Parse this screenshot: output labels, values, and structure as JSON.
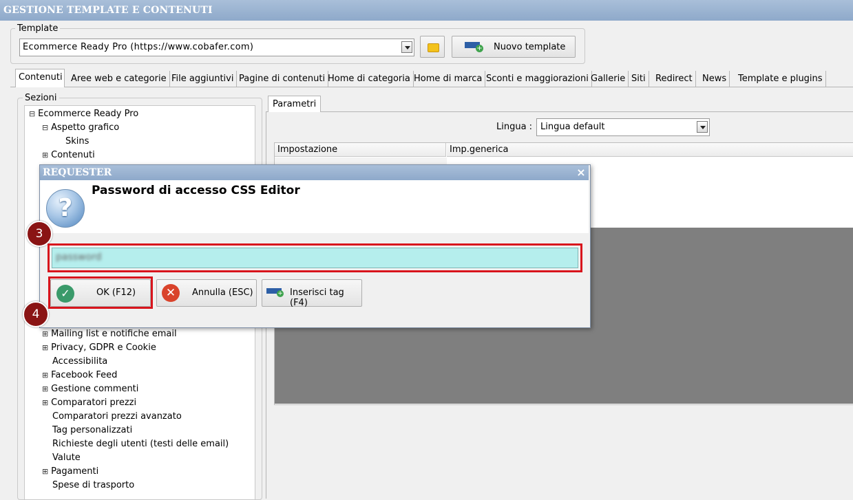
{
  "window": {
    "title": "GESTIONE TEMPLATE E CONTENUTI"
  },
  "template_group": {
    "legend": "Template",
    "selected": "Ecommerce Ready Pro (https://www.cobafer.com)",
    "new_button_label": "Nuovo template"
  },
  "tabs": [
    "Contenuti",
    "Aree web e categorie",
    "File aggiuntivi",
    "Pagine di contenuti",
    "Home di categoria",
    "Home di marca",
    "Sconti e maggiorazioni",
    "Gallerie",
    "Siti",
    "Redirect",
    "News",
    "Template e plugins"
  ],
  "sections": {
    "legend": "Sezioni",
    "tree": [
      "Ecommerce Ready Pro",
      "Aspetto grafico",
      "Skins",
      "Contenuti",
      "Mailing list e notifiche email",
      "Privacy, GDPR e Cookie",
      "Accessibilita",
      "Facebook Feed",
      "Gestione commenti",
      "Comparatori prezzi",
      "Comparatori prezzi avanzato",
      "Tag personalizzati",
      "Richieste degli utenti (testi delle email)",
      "Valute",
      "Pagamenti",
      "Spese di trasporto"
    ]
  },
  "params": {
    "tab": "Parametri",
    "lingua_label": "Lingua :",
    "lingua_value": "Lingua default",
    "col_setting": "Impostazione",
    "col_value": "Imp.generica"
  },
  "dialog": {
    "title": "REQUESTER",
    "message": "Password di accesso CSS Editor",
    "input_value": "password",
    "ok_label": "OK (F12)",
    "cancel_label": "Annulla (ESC)",
    "insert_tag_label": "Inserisci tag (F4)",
    "close_symbol": "×"
  },
  "markers": {
    "step3": "3",
    "step4": "4"
  },
  "colors": {
    "title_bar": "#9bb3d1",
    "highlight": "#d8141c",
    "marker": "#8a1414",
    "input_bg": "#b5eeed"
  }
}
